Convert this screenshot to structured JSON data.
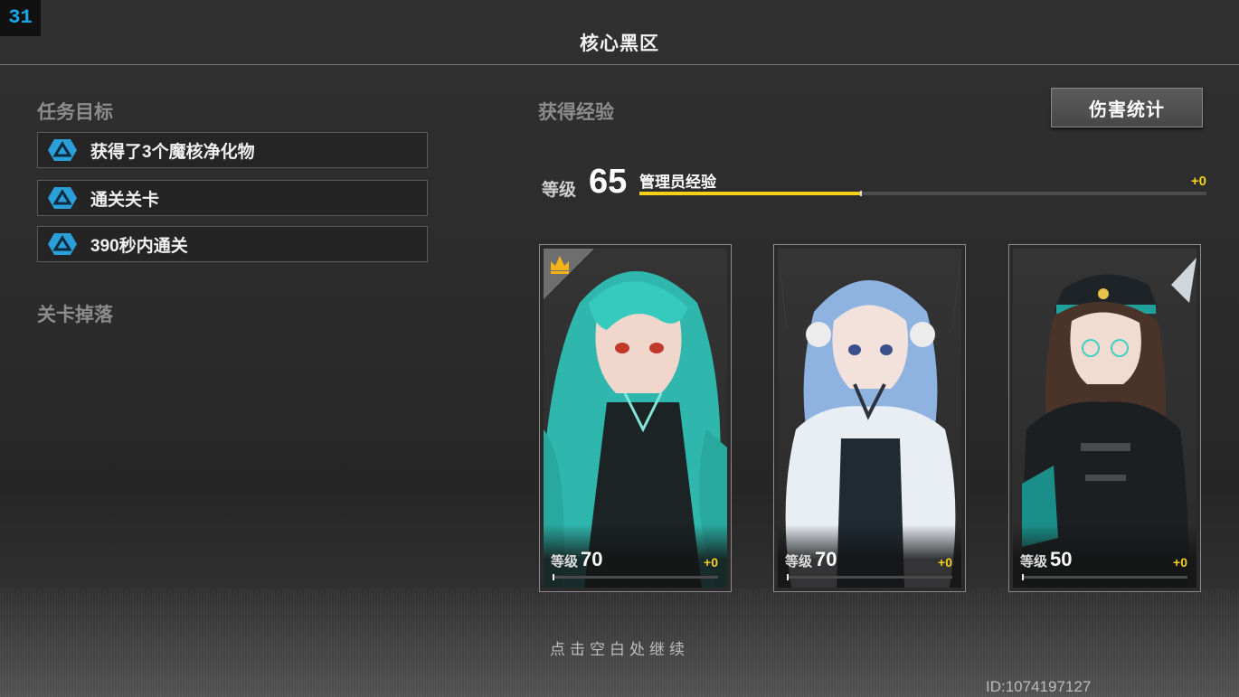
{
  "hud": {
    "fps": "31"
  },
  "header": {
    "title": "核心黑区"
  },
  "missions": {
    "heading": "任务目标",
    "items": [
      {
        "label": "获得了3个魔核净化物"
      },
      {
        "label": "通关关卡"
      },
      {
        "label": "390秒内通关"
      }
    ]
  },
  "drops": {
    "heading": "关卡掉落"
  },
  "exp": {
    "heading": "获得经验",
    "level_label": "等级",
    "level": "65",
    "bar_label": "管理员经验",
    "gain": "+0",
    "progress": 0.39
  },
  "damage_button": {
    "label": "伤害统计"
  },
  "characters": [
    {
      "level_label": "等级",
      "level": "70",
      "gain": "+0",
      "leader": true,
      "palette": "teal"
    },
    {
      "level_label": "等级",
      "level": "70",
      "gain": "+0",
      "leader": false,
      "palette": "ice"
    },
    {
      "level_label": "等级",
      "level": "50",
      "gain": "+0",
      "leader": false,
      "palette": "officer"
    }
  ],
  "footer": {
    "continue_hint": "点击空白处继续",
    "uid": "ID:1074197127"
  },
  "colors": {
    "accent_yellow": "#f5cf18",
    "mission_icon": "#2a9fd8"
  }
}
